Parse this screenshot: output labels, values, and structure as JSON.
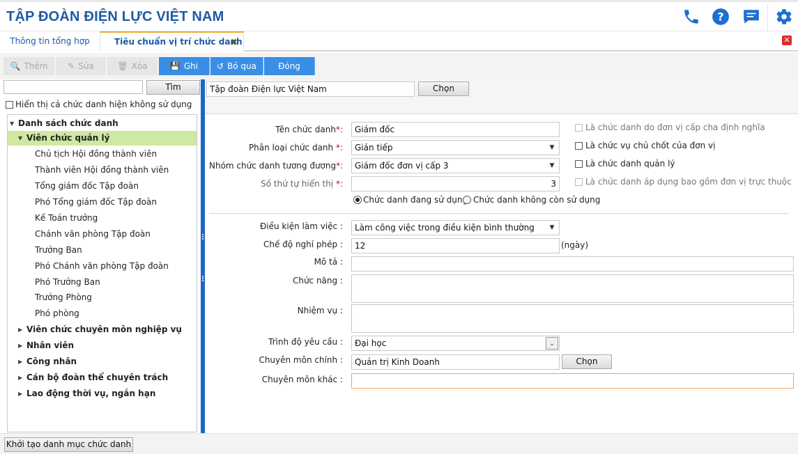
{
  "header": {
    "title": "TẬP ĐOÀN ĐIỆN LỰC VIỆT NAM",
    "icons": [
      "phone-icon",
      "help-icon",
      "chat-icon",
      "gear-icon"
    ],
    "accent": "#1d5aa6"
  },
  "tabs": [
    {
      "label": "Thông tin tổng hợp",
      "active": false
    },
    {
      "label": "Tiêu chuẩn vị trí chức danh",
      "active": true,
      "close": "✖"
    }
  ],
  "window_close": "✕",
  "toolbar": {
    "add": "Thêm",
    "edit": "Sửa",
    "delete": "Xóa",
    "save": "Ghi",
    "skip": "Bỏ qua",
    "close": "Đóng"
  },
  "left": {
    "search_value": "",
    "search_button": "Tìm",
    "show_unused_label": "Hiển thị cả chức danh hiện không sử dụng",
    "tree": {
      "root": "Danh sách chức danh",
      "groups": [
        {
          "label": "Viên chức quản lý",
          "expanded": true,
          "children": [
            "Chủ tịch Hội đồng thành viên",
            "Thành viên Hội đồng thành viên",
            "Tổng giám đốc Tập đoàn",
            "Phó Tổng giám đốc Tập đoàn",
            "Kế Toán trưởng",
            "Chánh văn phòng Tập đoàn",
            "Trưởng Ban",
            "Phó Chánh văn phòng Tập đoàn",
            "Phó Trưởng Ban",
            "Trưởng Phòng",
            "Phó phòng"
          ]
        },
        {
          "label": "Viên chức chuyên môn nghiệp vụ",
          "expanded": false
        },
        {
          "label": "Nhân viên",
          "expanded": false
        },
        {
          "label": "Công nhân",
          "expanded": false
        },
        {
          "label": "Cán bộ đoàn thể chuyên trách",
          "expanded": false
        },
        {
          "label": "Lao động thời vụ, ngắn hạn",
          "expanded": false
        }
      ]
    },
    "init_button": "Khởi tạo danh mục chức danh"
  },
  "right": {
    "org_value": "Tập đoàn Điện lực Việt Nam",
    "org_choose": "Chọn",
    "fields": {
      "title_label": "Tên chức danh",
      "title_value": "Giám đốc",
      "class_label": "Phân loại chức danh",
      "class_value": "Gián tiếp",
      "group_label": "Nhóm chức danh tương đương",
      "group_value": "Giám đốc đơn vị cấp 3",
      "order_label": "Số thứ tự hiển thị",
      "order_value": "3",
      "req_mark": "*:",
      "req_mark_sp": " *:"
    },
    "checks": [
      {
        "label": "Là chức danh do đơn vị cấp cha định nghĩa",
        "checked": false,
        "disabled": true
      },
      {
        "label": "Là chức vụ chủ chốt của đơn vị",
        "checked": false,
        "disabled": false
      },
      {
        "label": "Là chức danh quản lý",
        "checked": false,
        "disabled": false
      },
      {
        "label": "Là chức danh áp dụng bao gồm đơn vị trực thuộc",
        "checked": false,
        "disabled": true
      }
    ],
    "status": {
      "in_use": "Chức danh đang sử dụng",
      "not_in_use": "Chức danh không còn sử dụng",
      "selected": "in_use"
    },
    "details": {
      "work_cond_label": "Điều kiện làm việc :",
      "work_cond_value": "Làm công việc trong điều kiện bình thường",
      "leave_label": "Chế độ nghỉ phép :",
      "leave_value": "12",
      "leave_unit": "(ngày)",
      "desc_label": "Mô tả :",
      "desc_value": "",
      "function_label": "Chức năng :",
      "function_value": "",
      "duty_label": "Nhiệm vụ :",
      "duty_value": "",
      "edu_label": "Trình độ yêu cầu :",
      "edu_value": "Đại học",
      "major_label": "Chuyên môn chính :",
      "major_value": "Quản trị Kinh Doanh",
      "major_choose": "Chọn",
      "other_major_label": "Chuyên môn khác :",
      "other_major_value": ""
    }
  }
}
